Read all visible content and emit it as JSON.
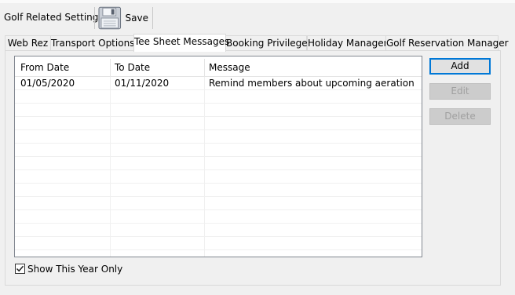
{
  "toolbar": {
    "title": "Golf Related Settings",
    "save_label": "Save"
  },
  "tabs": [
    {
      "label": "Web Rez",
      "active": false
    },
    {
      "label": "Transport Options",
      "active": false
    },
    {
      "label": "Tee Sheet Messages",
      "active": true
    },
    {
      "label": "Booking Privileges",
      "active": false
    },
    {
      "label": "Holiday Manager",
      "active": false
    },
    {
      "label": "Golf Reservation Manager",
      "active": false
    }
  ],
  "grid": {
    "columns": [
      "From Date",
      "To Date",
      "Message"
    ],
    "rows": [
      [
        "01/05/2020",
        "01/11/2020",
        "Remind members about upcoming aeration"
      ]
    ]
  },
  "buttons": {
    "add": "Add",
    "edit": "Edit",
    "delete": "Delete"
  },
  "show_this_year": {
    "label": "Show This Year Only",
    "checked": true
  },
  "colors": {
    "accent": "#0078d7",
    "window_bg": "#f0f0f0"
  }
}
